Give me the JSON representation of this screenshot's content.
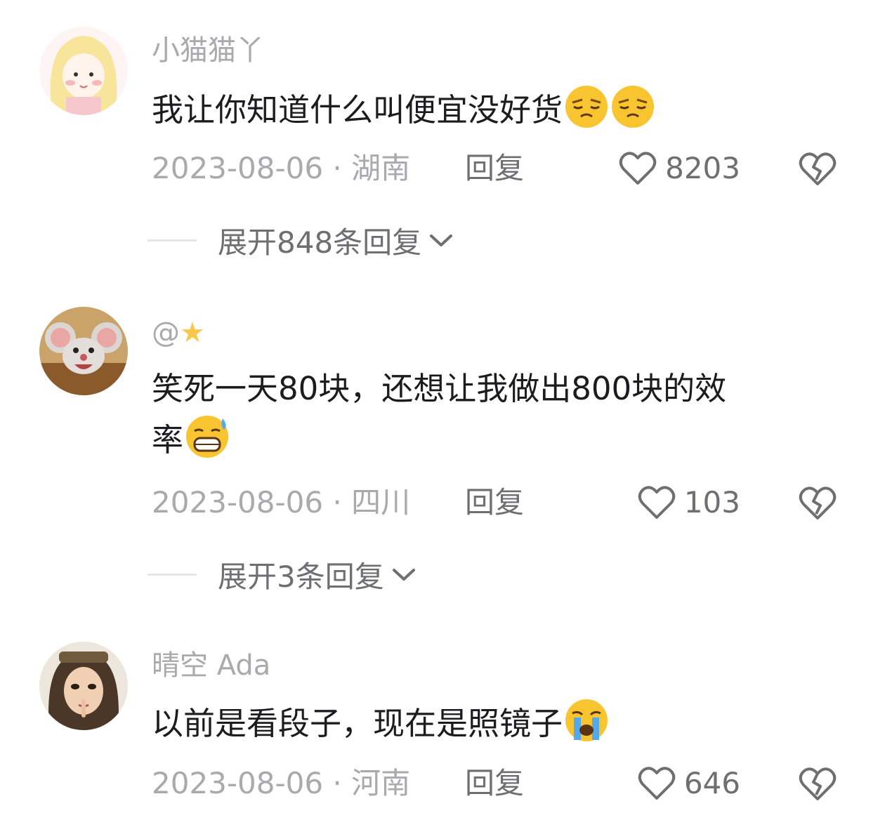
{
  "comments": [
    {
      "username": "小猫猫丫",
      "text": "我让你知道什么叫便宜没好货",
      "emojis": [
        "unamused-face-emoji",
        "unamused-face-emoji"
      ],
      "date_location": "2023-08-06 · 湖南",
      "reply_label": "回复",
      "likes": "8203",
      "expand_label": "展开848条回复"
    },
    {
      "username": "@",
      "username_icon": "star-icon",
      "text_line1": "笑死一天80块，还想让我做出800块的效",
      "text_line2": "率",
      "emojis": [
        "grinning-sweat-emoji"
      ],
      "date_location": "2023-08-06 · 四川",
      "reply_label": "回复",
      "likes": "103",
      "expand_label": "展开3条回复"
    },
    {
      "username": "晴空 Ada",
      "text": "以前是看段子，现在是照镜子",
      "emojis": [
        "loudly-crying-face-emoji"
      ],
      "date_location": "2023-08-06 · 河南",
      "reply_label": "回复",
      "likes": "646"
    }
  ],
  "colors": {
    "meta_text": "#a9a9ae",
    "body_text": "#1c1c20",
    "secondary_text": "#6e6e73"
  }
}
